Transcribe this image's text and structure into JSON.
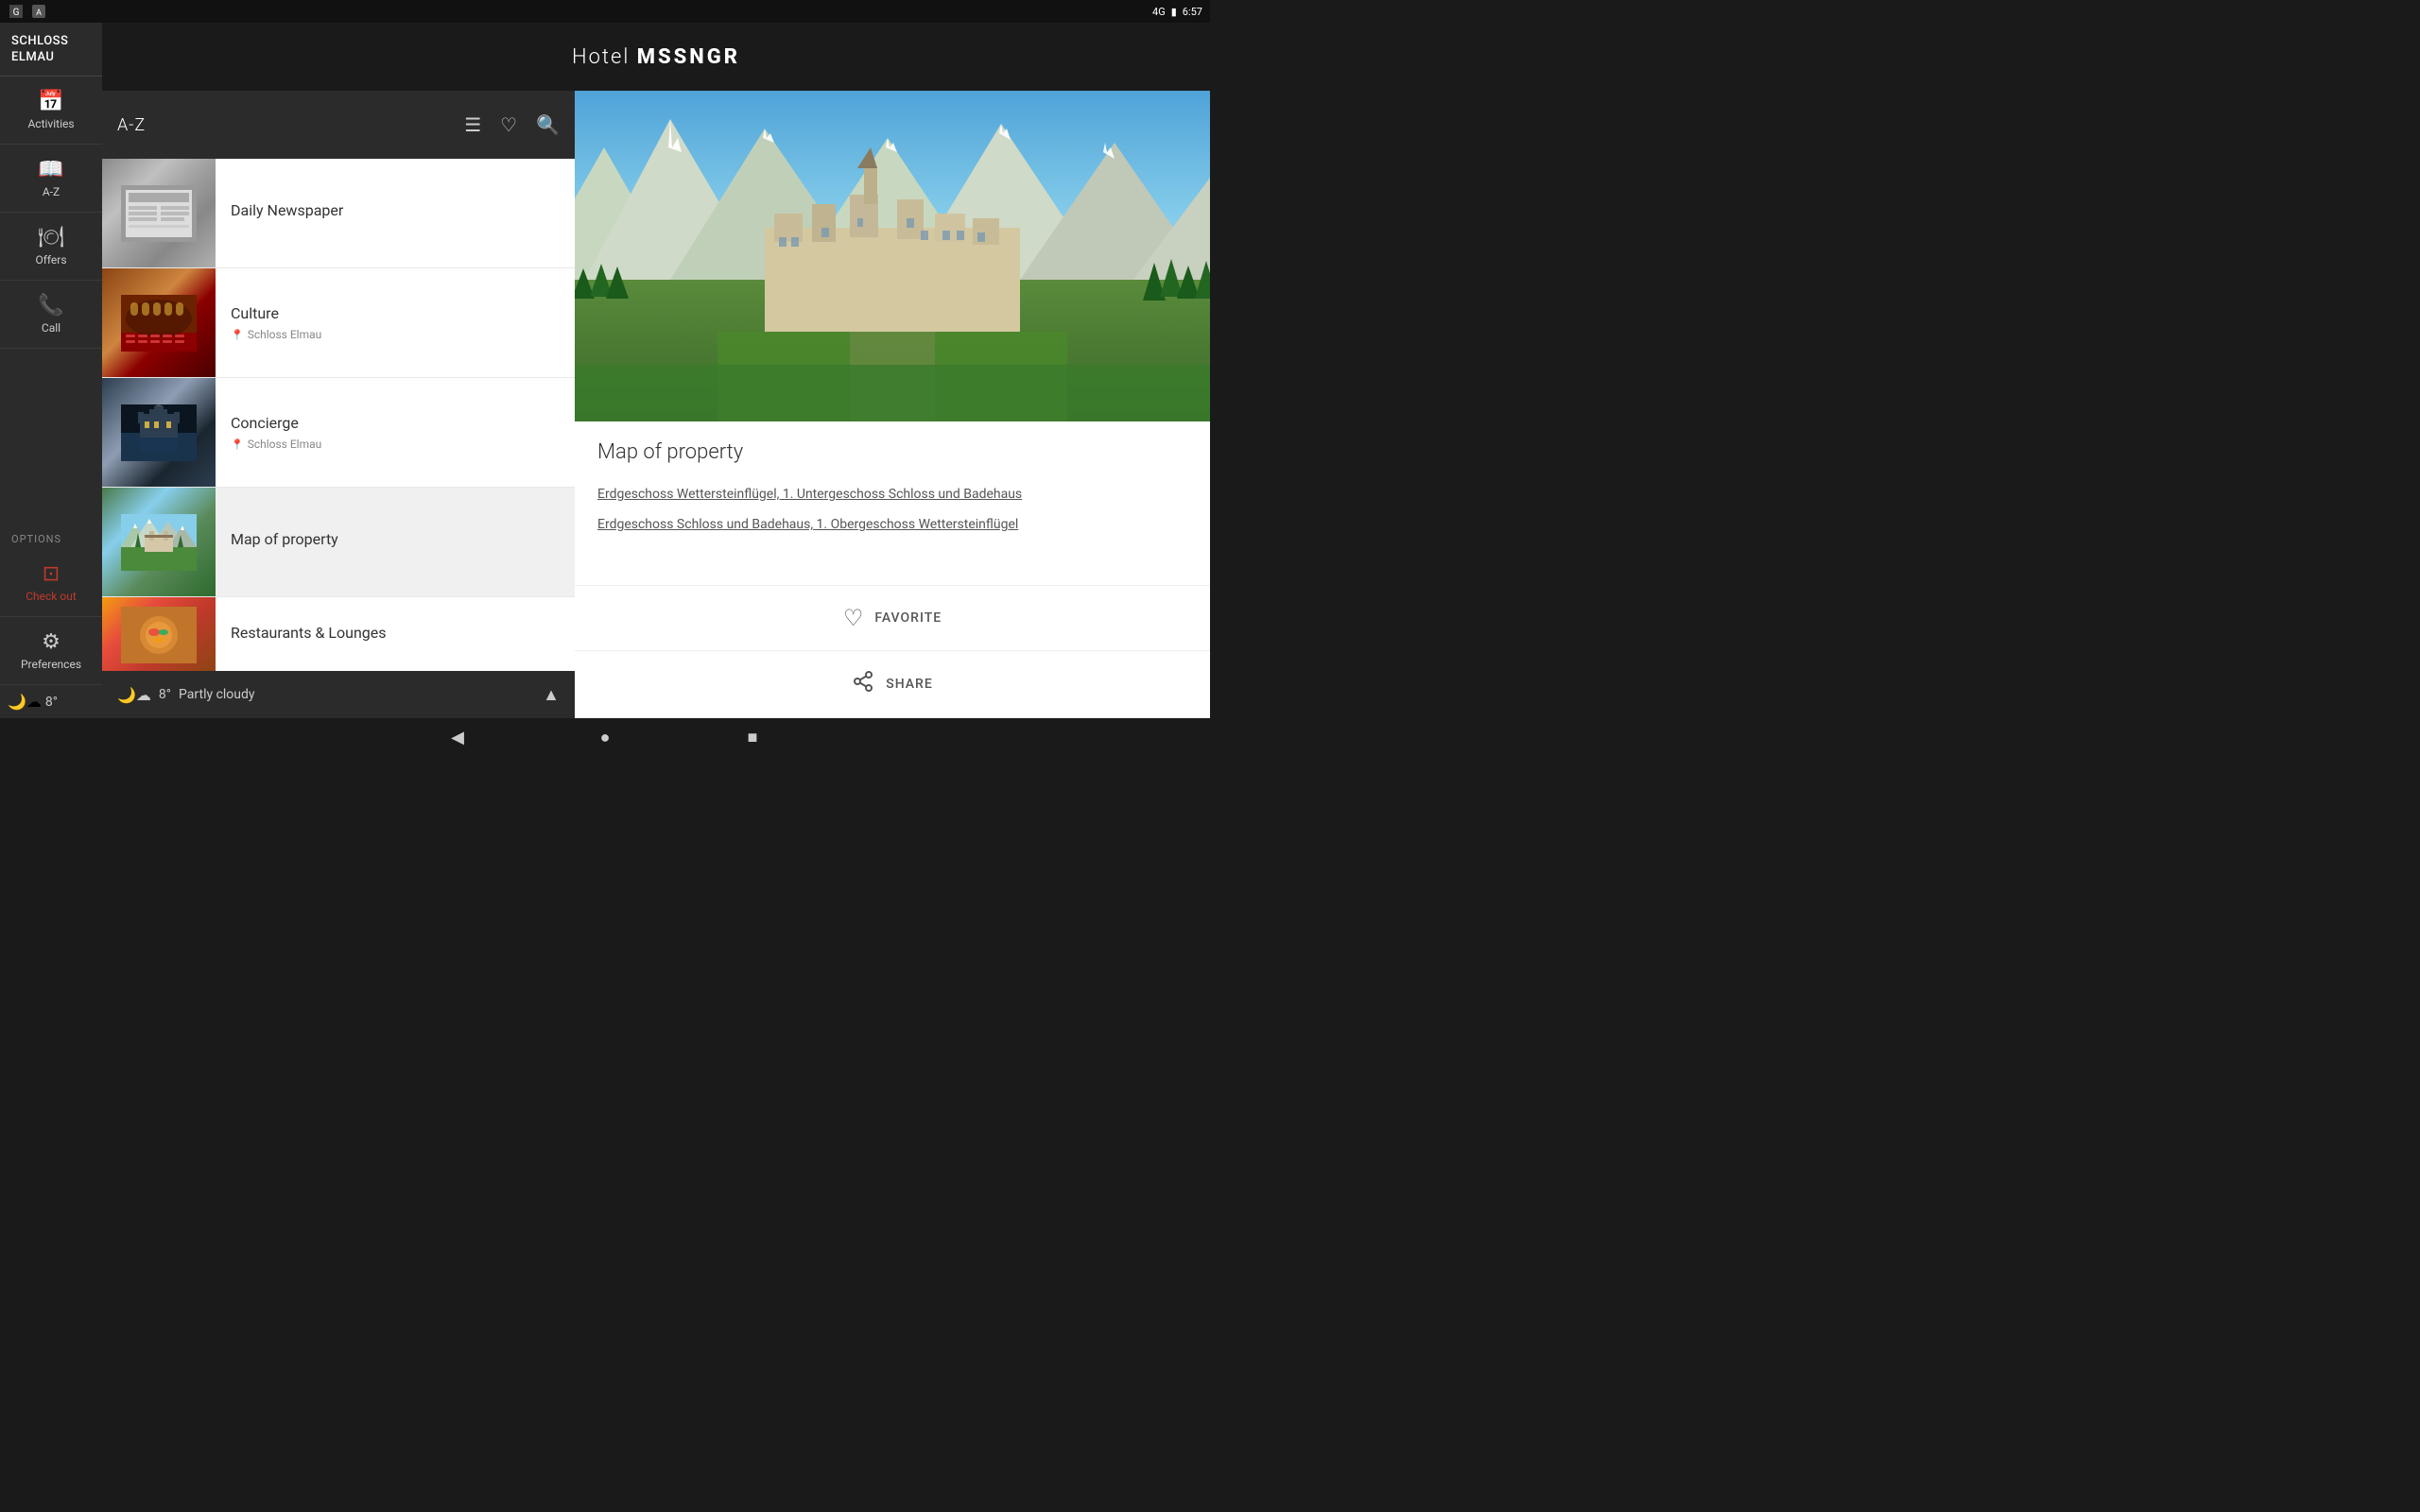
{
  "statusBar": {
    "time": "6:57",
    "signal": "4G",
    "batteryIcon": "🔋"
  },
  "hotelTitle": {
    "prefix": "Hotel ",
    "name": "MSSNGR"
  },
  "sidebar": {
    "hotelName": [
      "SCHLOSS",
      "ELMAU"
    ],
    "navItems": [
      {
        "id": "activities",
        "icon": "📅",
        "label": "Activities"
      },
      {
        "id": "a-z",
        "icon": "📖",
        "label": "A-Z"
      },
      {
        "id": "offers",
        "icon": "🍽",
        "label": "Offers"
      },
      {
        "id": "call",
        "icon": "📞",
        "label": "Call"
      }
    ],
    "optionsLabel": "OPTIONS",
    "optionItems": [
      {
        "id": "checkout",
        "icon": "🔲",
        "label": "Check out",
        "isRed": true
      },
      {
        "id": "preferences",
        "icon": "⚙",
        "label": "Preferences"
      }
    ],
    "weather": {
      "icon": "🌙☁",
      "temp": "8°"
    }
  },
  "listPanel": {
    "headerTitle": "A-Z",
    "headerIcons": [
      "☰",
      "♡",
      "🔍"
    ],
    "items": [
      {
        "id": "newspaper",
        "title": "Daily Newspaper",
        "subtitle": "",
        "thumbType": "newspaper",
        "thumbEmoji": "📰"
      },
      {
        "id": "culture",
        "title": "Culture",
        "subtitle": "Schloss Elmau",
        "hasLocation": true,
        "thumbType": "culture",
        "thumbEmoji": "🎭"
      },
      {
        "id": "concierge",
        "title": "Concierge",
        "subtitle": "Schloss Elmau",
        "hasLocation": true,
        "thumbType": "concierge",
        "thumbEmoji": "🏰"
      },
      {
        "id": "map",
        "title": "Map of property",
        "subtitle": "",
        "thumbType": "map",
        "thumbEmoji": "🗺"
      },
      {
        "id": "restaurants",
        "title": "Restaurants & Lounges",
        "subtitle": "",
        "thumbType": "restaurant",
        "thumbEmoji": "🍽"
      }
    ],
    "weather": {
      "icon": "🌙☁",
      "temp": "8°",
      "description": "Partly cloudy",
      "chevron": "▲"
    }
  },
  "detailPanel": {
    "title": "Map of property",
    "links": [
      "Erdgeschoss Wettersteinflügel, 1. Untergeschoss Schloss und Badehaus",
      "Erdgeschoss Schloss und Badehaus,  1. Obergeschoss Wettersteinflügel"
    ],
    "actions": [
      {
        "id": "favorite",
        "icon": "♡",
        "label": "FAVORITE"
      },
      {
        "id": "share",
        "icon": "share",
        "label": "SHARE"
      }
    ]
  },
  "navBar": {
    "back": "◀",
    "home": "●",
    "recent": "■"
  }
}
